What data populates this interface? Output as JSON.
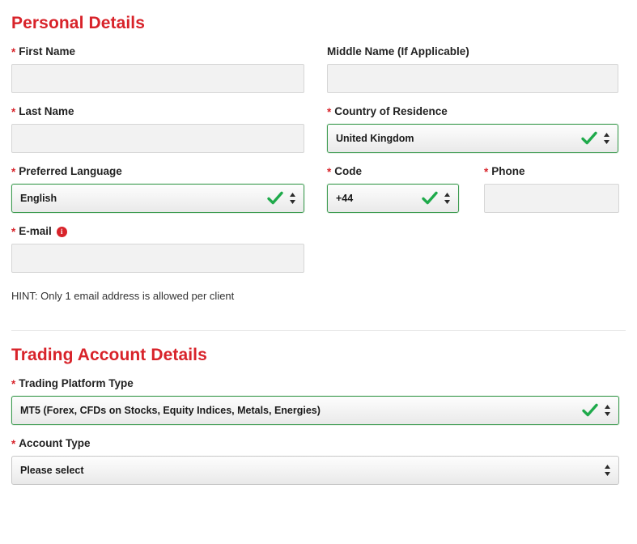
{
  "theme": {
    "accent_red": "#d8232a",
    "valid_green": "#3f9c52",
    "input_bg": "#f2f2f2",
    "input_border": "#d6d6d6"
  },
  "personal_section": {
    "title": "Personal Details",
    "fields": {
      "first_name": {
        "label": "First Name",
        "required_marker": "*",
        "value": "",
        "placeholder": ""
      },
      "middle_name": {
        "label": "Middle Name (If Applicable)",
        "required_marker": "",
        "value": "",
        "placeholder": ""
      },
      "last_name": {
        "label": "Last Name",
        "required_marker": "*",
        "value": "",
        "placeholder": ""
      },
      "country_of_residence": {
        "label": "Country of Residence",
        "required_marker": "*",
        "value": "United Kingdom",
        "state": "valid"
      },
      "preferred_language": {
        "label": "Preferred Language",
        "required_marker": "*",
        "value": "English",
        "state": "valid"
      },
      "code": {
        "label": "Code",
        "required_marker": "*",
        "value": "+44",
        "state": "valid"
      },
      "phone": {
        "label": "Phone",
        "required_marker": "*",
        "value": "",
        "placeholder": ""
      },
      "email": {
        "label": "E-mail",
        "required_marker": "*",
        "info_icon_glyph": "i",
        "value": "",
        "placeholder": ""
      }
    },
    "hint": "HINT: Only 1 email address is allowed per client"
  },
  "trading_section": {
    "title": "Trading Account Details",
    "fields": {
      "trading_platform_type": {
        "label": "Trading Platform Type",
        "required_marker": "*",
        "value": "MT5 (Forex, CFDs on Stocks, Equity Indices, Metals, Energies)",
        "state": "valid"
      },
      "account_type": {
        "label": "Account Type",
        "required_marker": "*",
        "value": "Please select",
        "state": "neutral"
      }
    }
  },
  "icons": {
    "valid_check": "check-icon",
    "stepper": "stepper-arrows-icon",
    "info": "info-icon"
  }
}
